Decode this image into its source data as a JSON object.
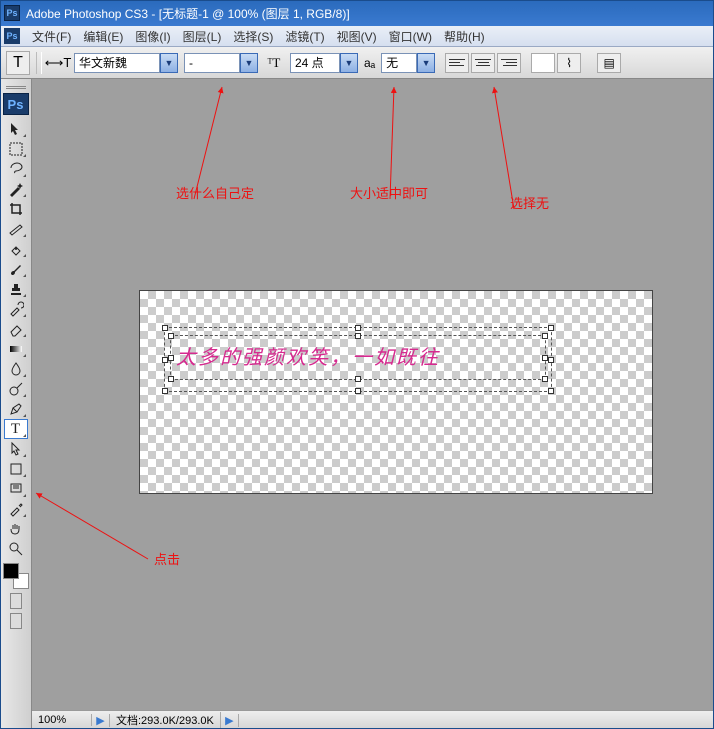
{
  "window": {
    "title": "Adobe Photoshop CS3 - [无标题-1 @ 100% (图层 1, RGB/8)]"
  },
  "menubar": {
    "items": [
      "文件(F)",
      "编辑(E)",
      "图像(I)",
      "图层(L)",
      "选择(S)",
      "滤镜(T)",
      "视图(V)",
      "窗口(W)",
      "帮助(H)"
    ]
  },
  "options": {
    "tool_letter": "T",
    "font_family": "华文新魏",
    "font_style": "-",
    "font_size": "24 点",
    "aa_label": "aₐ",
    "aa_value": "无"
  },
  "canvas_text": "太多的强颜欢笑，一如既往",
  "annotations": {
    "font_note": "选什么自己定",
    "size_note": "大小适中即可",
    "aa_note": "选择无",
    "click_note": "点击"
  },
  "status": {
    "zoom": "100%",
    "doc_info": "文档:293.0K/293.0K"
  },
  "tool_names": [
    "move",
    "marquee",
    "lasso",
    "wand",
    "crop",
    "slice",
    "heal",
    "brush",
    "stamp",
    "history-brush",
    "eraser",
    "gradient",
    "blur",
    "dodge",
    "pen",
    "type",
    "path-sel",
    "shape",
    "notes",
    "eyedropper",
    "hand",
    "zoom"
  ]
}
